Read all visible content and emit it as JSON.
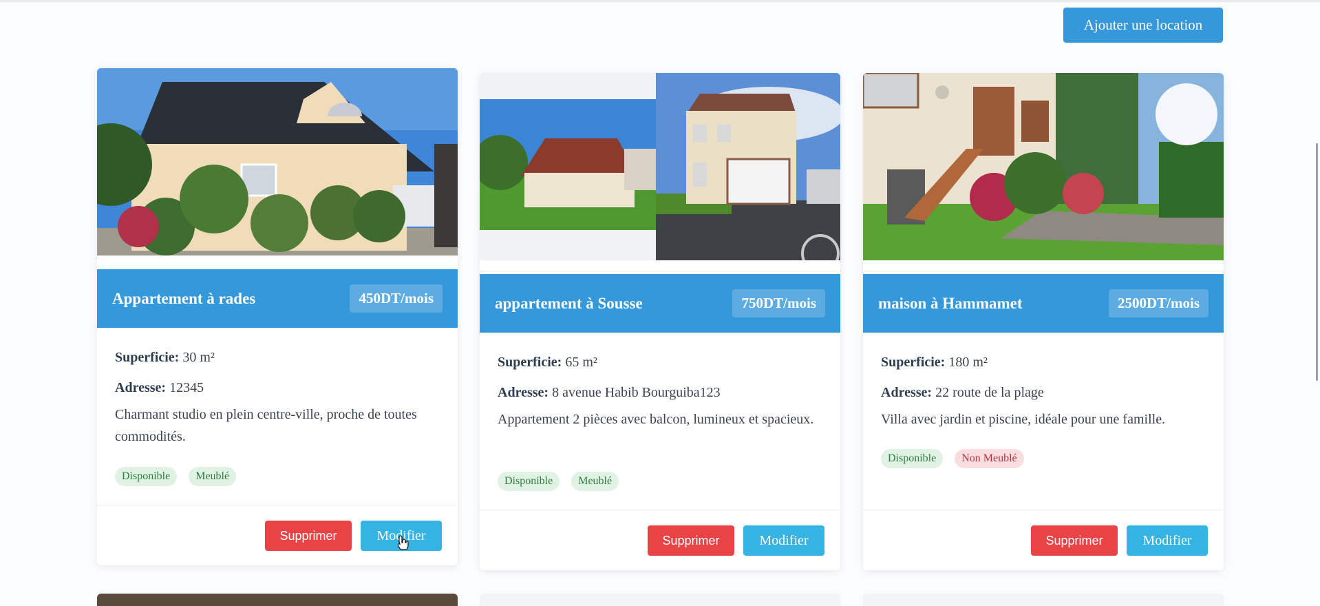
{
  "header": {
    "add_button_label": "Ajouter une location"
  },
  "labels": {
    "superficie": "Superficie:",
    "adresse": "Adresse:"
  },
  "listings": [
    {
      "title": "Appartement à rades",
      "price": "450DT/mois",
      "superficie": "30 m²",
      "adresse": "12345",
      "description": "Charmant studio en plein centre-ville, proche de toutes commodités.",
      "badges": [
        {
          "label": "Disponible",
          "status": "green"
        },
        {
          "label": "Meublé",
          "status": "green"
        }
      ],
      "delete_label": "Supprimer",
      "edit_label": "Modifier"
    },
    {
      "title": "appartement à Sousse",
      "price": "750DT/mois",
      "superficie": "65 m²",
      "adresse": "8 avenue Habib Bourguiba123",
      "description": "Appartement 2 pièces avec balcon, lumineux et spacieux.",
      "badges": [
        {
          "label": "Disponible",
          "status": "green"
        },
        {
          "label": "Meublé",
          "status": "green"
        }
      ],
      "delete_label": "Supprimer",
      "edit_label": "Modifier"
    },
    {
      "title": "maison à Hammamet",
      "price": "2500DT/mois",
      "superficie": "180 m²",
      "adresse": "22 route de la plage",
      "description": "Villa avec jardin et piscine, idéale pour une famille.",
      "badges": [
        {
          "label": "Disponible",
          "status": "green"
        },
        {
          "label": "Non Meublé",
          "status": "red"
        }
      ],
      "delete_label": "Supprimer",
      "edit_label": "Modifier"
    }
  ],
  "colors": {
    "accent": "#3498db",
    "danger": "#ea4346",
    "info": "#35b3e2"
  }
}
